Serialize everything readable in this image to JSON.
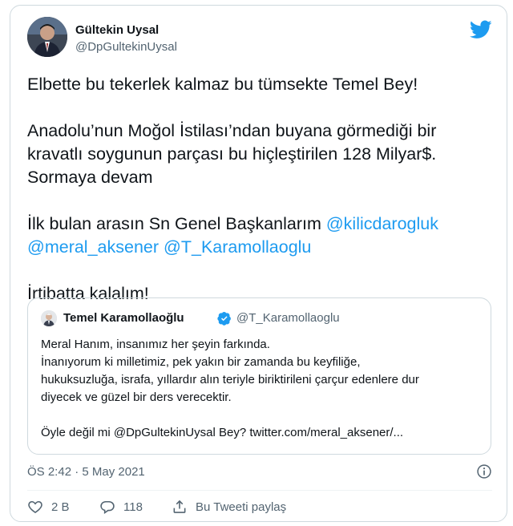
{
  "tweet": {
    "author": {
      "name": "Gültekin Uysal",
      "handle": "@DpGultekinUysal"
    },
    "body": {
      "p1": "Elbette bu tekerlek kalmaz bu tümsekte Temel Bey!",
      "p2_line1": "Anadolu’nun Moğol İstilası’ndan buyana görmediği bir",
      "p2_line2": "kravatlı soygunun parçası bu hiçleştirilen 128 Milyar$.",
      "p2_line3": "Sormaya devam",
      "p3_prefix": "İlk bulan arasın Sn Genel Başkanlarım ",
      "p3_mention1": "@kilicdarogluk",
      "p3_mention2": "@meral_aksener",
      "p3_mention3": "@T_Karamollaoglu",
      "p4": "İrtibatta kalalım!"
    },
    "quoted": {
      "name": "Temel Karamollaoğlu",
      "handle": "@T_Karamollaoglu",
      "lines": [
        "Meral Hanım, insanımız her şeyin farkında.",
        "İnanıyorum ki milletimiz, pek yakın bir zamanda bu keyfiliğe,",
        "hukuksuzluğa, israfa, yıllardır alın teriyle biriktirileni çarçur edenlere dur",
        "diyecek ve güzel bir ders verecektir."
      ],
      "last_line": "Öyle değil mi @DpGultekinUysal Bey? twitter.com/meral_aksener/..."
    },
    "timestamp": "ÖS 2:42 · 5 May 2021",
    "actions": {
      "likes": "2 B",
      "replies": "118",
      "share_label": "Bu Tweeti paylaş"
    }
  },
  "colors": {
    "accent": "#1d9bf0",
    "text": "#0f1419",
    "muted": "#536471",
    "border": "#cfd9de"
  }
}
